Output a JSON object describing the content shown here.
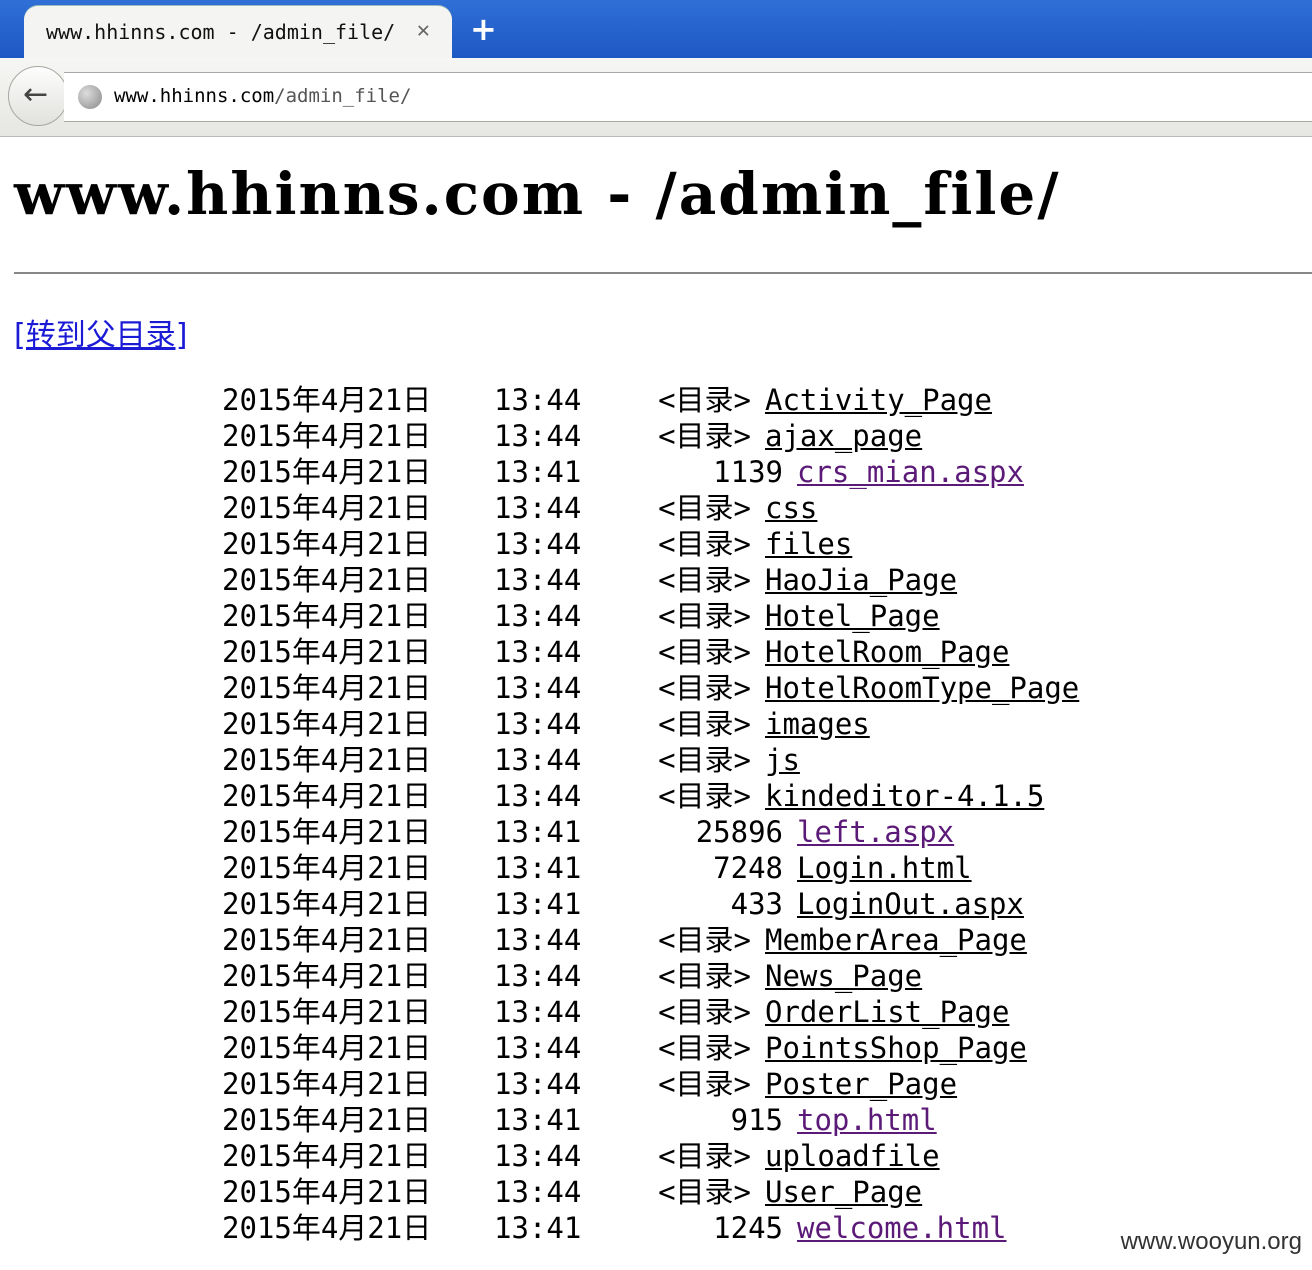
{
  "browser": {
    "tab_title": "www.hhinns.com - /admin_file/",
    "tab_close": "✕",
    "new_tab": "+",
    "back": "←",
    "url_host": "www.hhinns.com",
    "url_path": "/admin_file/"
  },
  "page": {
    "title": "www.hhinns.com - /admin_file/",
    "parent_link": "[转到父目录]"
  },
  "entries": [
    {
      "date": "2015年4月21日",
      "time": "13:44",
      "size": "<目录>",
      "name": "Activity_Page",
      "dir": true,
      "visited": false
    },
    {
      "date": "2015年4月21日",
      "time": "13:44",
      "size": "<目录>",
      "name": "ajax_page",
      "dir": true,
      "visited": false
    },
    {
      "date": "2015年4月21日",
      "time": "13:41",
      "size": "1139",
      "name": "crs_mian.aspx",
      "dir": false,
      "visited": true
    },
    {
      "date": "2015年4月21日",
      "time": "13:44",
      "size": "<目录>",
      "name": "css",
      "dir": true,
      "visited": false
    },
    {
      "date": "2015年4月21日",
      "time": "13:44",
      "size": "<目录>",
      "name": "files",
      "dir": true,
      "visited": false
    },
    {
      "date": "2015年4月21日",
      "time": "13:44",
      "size": "<目录>",
      "name": "HaoJia_Page",
      "dir": true,
      "visited": false
    },
    {
      "date": "2015年4月21日",
      "time": "13:44",
      "size": "<目录>",
      "name": "Hotel_Page",
      "dir": true,
      "visited": false
    },
    {
      "date": "2015年4月21日",
      "time": "13:44",
      "size": "<目录>",
      "name": "HotelRoom_Page",
      "dir": true,
      "visited": false
    },
    {
      "date": "2015年4月21日",
      "time": "13:44",
      "size": "<目录>",
      "name": "HotelRoomType_Page",
      "dir": true,
      "visited": false
    },
    {
      "date": "2015年4月21日",
      "time": "13:44",
      "size": "<目录>",
      "name": "images",
      "dir": true,
      "visited": false
    },
    {
      "date": "2015年4月21日",
      "time": "13:44",
      "size": "<目录>",
      "name": "js",
      "dir": true,
      "visited": false
    },
    {
      "date": "2015年4月21日",
      "time": "13:44",
      "size": "<目录>",
      "name": "kindeditor-4.1.5",
      "dir": true,
      "visited": false
    },
    {
      "date": "2015年4月21日",
      "time": "13:41",
      "size": "25896",
      "name": "left.aspx",
      "dir": false,
      "visited": true
    },
    {
      "date": "2015年4月21日",
      "time": "13:41",
      "size": "7248",
      "name": "Login.html",
      "dir": false,
      "visited": false
    },
    {
      "date": "2015年4月21日",
      "time": "13:41",
      "size": "433",
      "name": "LoginOut.aspx",
      "dir": false,
      "visited": false
    },
    {
      "date": "2015年4月21日",
      "time": "13:44",
      "size": "<目录>",
      "name": "MemberArea_Page",
      "dir": true,
      "visited": false
    },
    {
      "date": "2015年4月21日",
      "time": "13:44",
      "size": "<目录>",
      "name": "News_Page",
      "dir": true,
      "visited": false
    },
    {
      "date": "2015年4月21日",
      "time": "13:44",
      "size": "<目录>",
      "name": "OrderList_Page",
      "dir": true,
      "visited": false
    },
    {
      "date": "2015年4月21日",
      "time": "13:44",
      "size": "<目录>",
      "name": "PointsShop_Page",
      "dir": true,
      "visited": false
    },
    {
      "date": "2015年4月21日",
      "time": "13:44",
      "size": "<目录>",
      "name": "Poster_Page",
      "dir": true,
      "visited": false
    },
    {
      "date": "2015年4月21日",
      "time": "13:41",
      "size": "915",
      "name": "top.html",
      "dir": false,
      "visited": true
    },
    {
      "date": "2015年4月21日",
      "time": "13:44",
      "size": "<目录>",
      "name": "uploadfile",
      "dir": true,
      "visited": false
    },
    {
      "date": "2015年4月21日",
      "time": "13:44",
      "size": "<目录>",
      "name": "User_Page",
      "dir": true,
      "visited": false
    },
    {
      "date": "2015年4月21日",
      "time": "13:41",
      "size": "1245",
      "name": "welcome.html",
      "dir": false,
      "visited": true
    }
  ],
  "watermark": "www.wooyun.org",
  "colors": {
    "link": "#1b1bd6",
    "visited": "#5c1a78",
    "tabbar": "#1e58c4"
  }
}
